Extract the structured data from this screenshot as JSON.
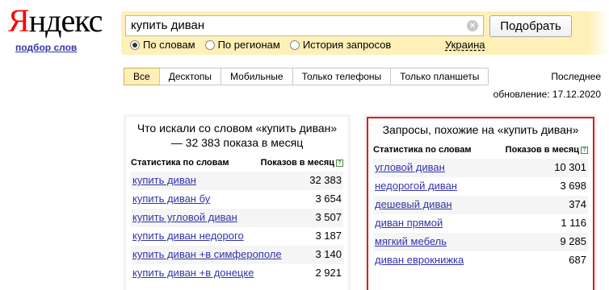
{
  "logo": {
    "first_letter": "Я",
    "rest": "ндекс"
  },
  "subtitle": "подбор слов",
  "search": {
    "query": "купить диван",
    "clear_glyph": "×",
    "button": "Подобрать"
  },
  "radio_options": [
    {
      "label": "По словам",
      "selected": true
    },
    {
      "label": "По регионам",
      "selected": false
    },
    {
      "label": "История запросов",
      "selected": false
    }
  ],
  "region": "Украина",
  "device_tabs": [
    {
      "label": "Все",
      "active": true
    },
    {
      "label": "Десктопы",
      "active": false
    },
    {
      "label": "Мобильные",
      "active": false
    },
    {
      "label": "Только телефоны",
      "active": false
    },
    {
      "label": "Только планшеты",
      "active": false
    }
  ],
  "updated": {
    "line1": "Последнее",
    "line2": "обновление: 17.12.2020"
  },
  "left_panel": {
    "title": "Что искали со словом «купить диван» — 32 383 показа в месяц",
    "col_phrase": "Статистика по словам",
    "col_count": "Показов в месяц",
    "rows": [
      {
        "phrase": "купить диван",
        "count": "32 383"
      },
      {
        "phrase": "купить диван бу",
        "count": "3 654"
      },
      {
        "phrase": "купить угловой диван",
        "count": "3 507"
      },
      {
        "phrase": "купить диван недорого",
        "count": "3 187"
      },
      {
        "phrase": "купить диван +в симферополе",
        "count": "3 140"
      },
      {
        "phrase": "купить диван +в донецке",
        "count": "2 921"
      }
    ]
  },
  "right_panel": {
    "title": "Запросы, похожие на «купить диван»",
    "col_phrase": "Статистика по словам",
    "col_count": "Показов в месяц",
    "rows": [
      {
        "phrase": "угловой диван",
        "count": "10 301"
      },
      {
        "phrase": "недорогой диван",
        "count": "3 698"
      },
      {
        "phrase": "дешевый диван",
        "count": "374"
      },
      {
        "phrase": "диван прямой",
        "count": "1 116"
      },
      {
        "phrase": "мягкий мебель",
        "count": "9 285"
      },
      {
        "phrase": "диван еврокнижка",
        "count": "687"
      }
    ]
  },
  "colors": {
    "accent": "#fff0b8",
    "link": "#3333aa",
    "highlight_border": "#d12020",
    "logo_red": "#ff0000"
  }
}
